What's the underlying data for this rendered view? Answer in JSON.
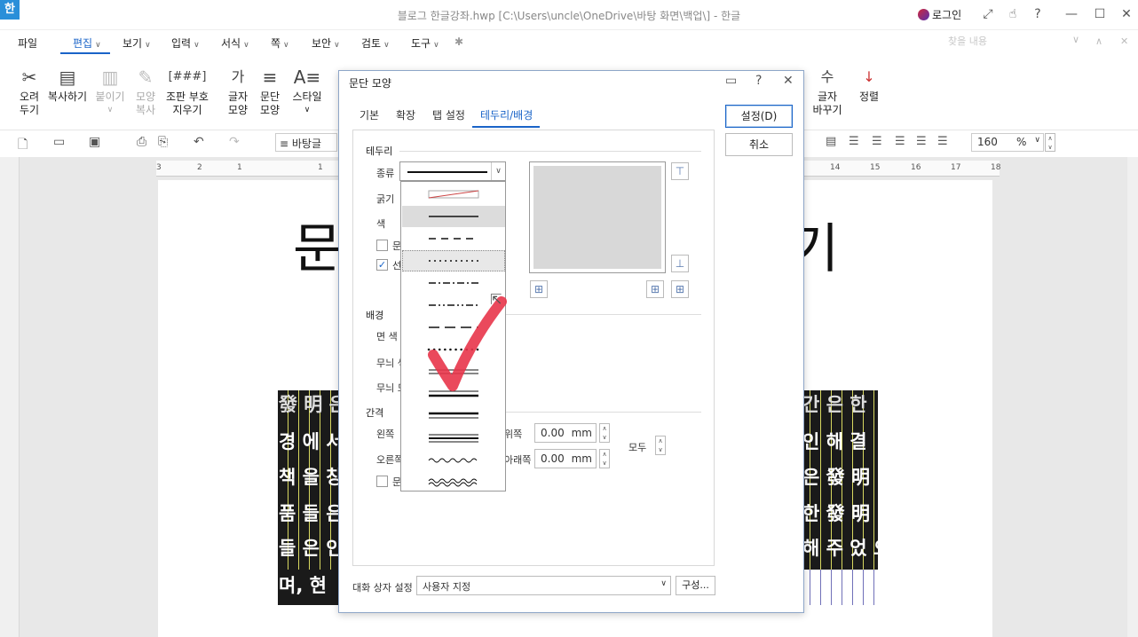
{
  "window": {
    "app_logo": "한",
    "title": "블로그 한글강좌.hwp [C:\\Users\\uncle\\OneDrive\\바탕 화면\\백업\\] - 한글",
    "login_label": "로그인",
    "icons": [
      "collapse-icon",
      "touch-icon",
      "help-icon",
      "minimize-icon",
      "maximize-icon",
      "close-icon"
    ]
  },
  "menubar": {
    "file": "파일",
    "edit": "편집",
    "view": "보기",
    "input": "입력",
    "format": "서식",
    "page": "쪽",
    "security": "보안",
    "review": "검토",
    "tools": "도구",
    "search_placeholder": "찾을 내용"
  },
  "ribbon": {
    "cut": [
      "오려",
      "두기"
    ],
    "copy": "복사하기",
    "paste": "붙이기",
    "format_copy": [
      "모양",
      "복사"
    ],
    "layout_code": [
      "조판 부호",
      "지우기"
    ],
    "char_shape": [
      "글자",
      "모양"
    ],
    "para_shape": [
      "문단",
      "모양"
    ],
    "style": "스타일",
    "char_change": [
      "글자",
      "바꾸기"
    ],
    "sort": "정렬"
  },
  "toolbar2": {
    "style_value": "바탕글",
    "zoom_value": "160",
    "zoom_unit": "%"
  },
  "ruler": [
    "3",
    "2",
    "1",
    "1",
    "2",
    "3",
    "14",
    "15",
    "16",
    "17",
    "18"
  ],
  "document": {
    "title_start": "문",
    "title_end": "기",
    "lines": [
      {
        "left": "發 明 은",
        "right": "간 은 한"
      },
      {
        "left": "경 에 서",
        "right": "인 해 결"
      },
      {
        "left": "책 을 창",
        "right": "은 發 明"
      },
      {
        "left": "품 들 은",
        "right": "한 發 明"
      },
      {
        "left": "들 은 인",
        "right": "해 주 었 으"
      },
      {
        "left": "며, 현",
        "right": ""
      }
    ]
  },
  "dialog": {
    "title": "문단 모양",
    "tabs": [
      "기본",
      "확장",
      "탭 설정",
      "테두리/배경"
    ],
    "active_tab": "테두리/배경",
    "ok_label": "설정(D)",
    "cancel_label": "취소",
    "border": {
      "section": "테두리",
      "type_label": "종류",
      "thickness_label": "굵기",
      "color_label": "색",
      "check1_label": "문",
      "check2_label": "선",
      "check2_checked": true
    },
    "line_types": [
      "none",
      "solid",
      "dashed",
      "dotted",
      "dash-dot",
      "dash-dot-dot",
      "long-dash",
      "round-dot",
      "double",
      "thin-thick",
      "thick-thin",
      "triple",
      "wave",
      "double-wave"
    ],
    "background": {
      "section": "배경",
      "face_color_label": "면 색",
      "pattern_color_label": "무늬 색",
      "pattern_shape_label": "무늬 모"
    },
    "spacing": {
      "section": "간격",
      "left_label": "왼쪽",
      "right_label": "오른쪽",
      "top_label": "위쪽",
      "bottom_label": "아래쪽",
      "top_value": "0.00",
      "bottom_value": "0.00",
      "unit": "mm",
      "all_label": "모두",
      "check_label": "문"
    },
    "footer": {
      "setting_label": "대화 상자 설정",
      "setting_value": "사용자 지정",
      "config_label": "구성..."
    }
  }
}
